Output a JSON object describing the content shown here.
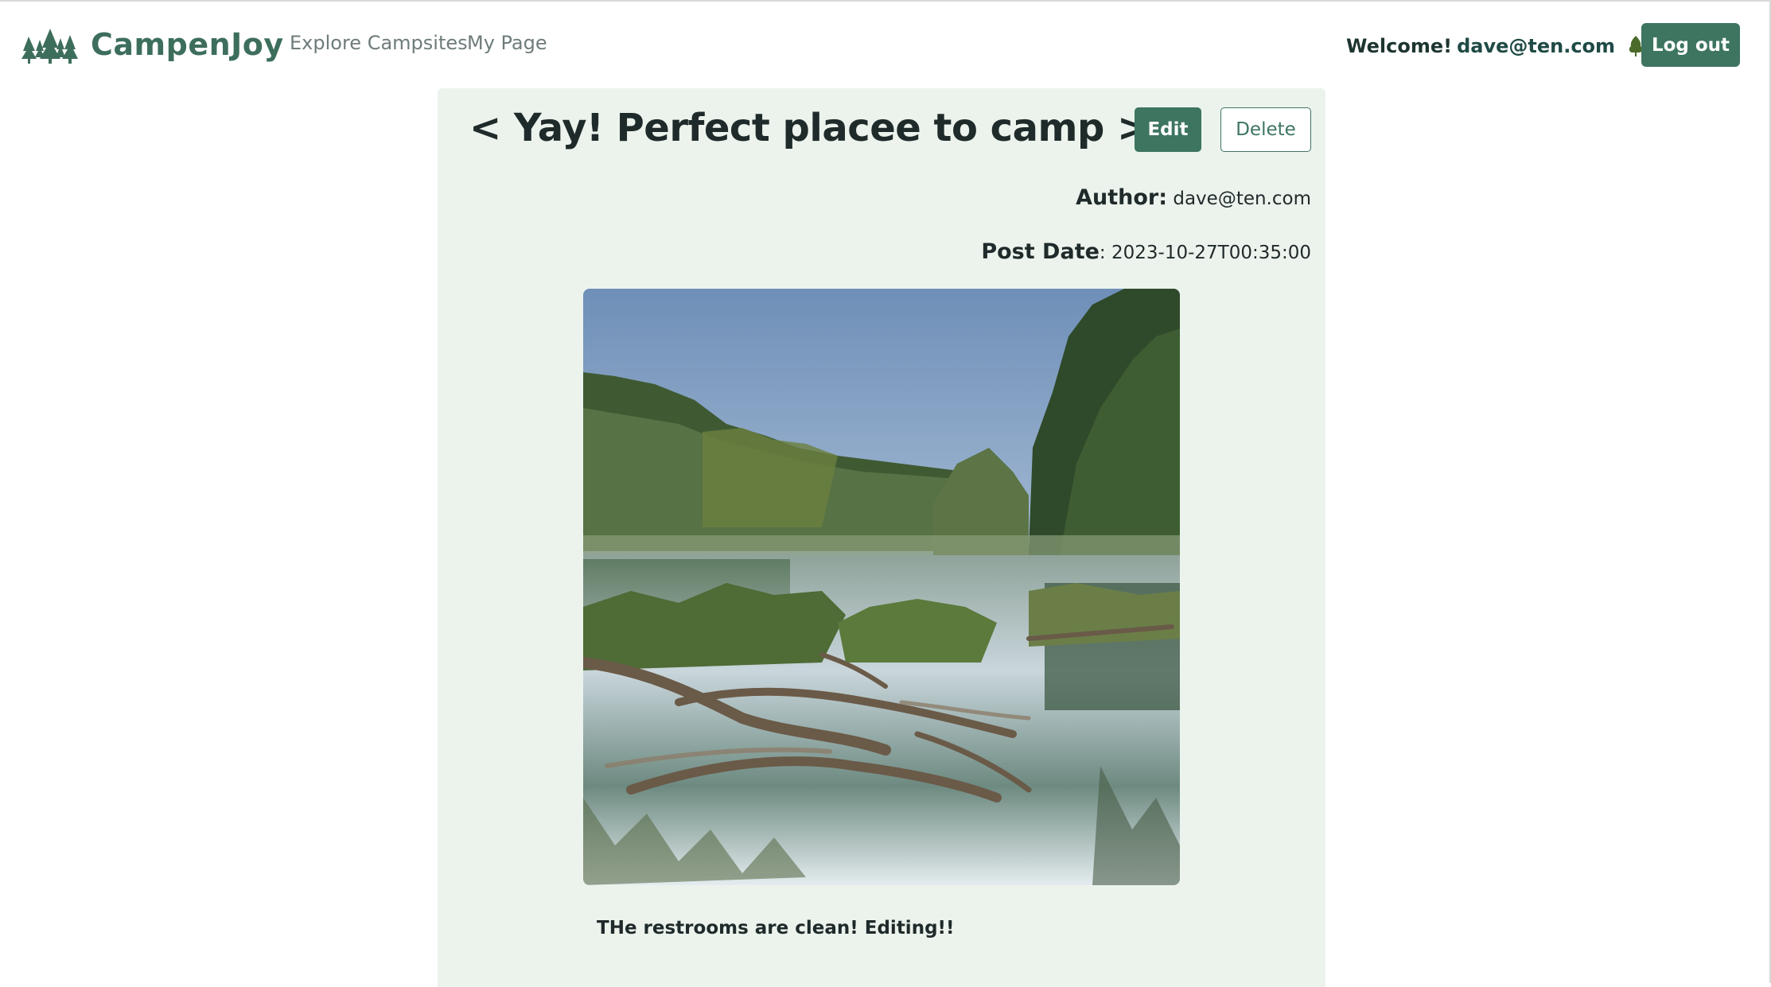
{
  "navbar": {
    "brand": "CampenJoy",
    "links": [
      "Explore Campsites",
      "My Page"
    ],
    "welcome_text": "Welcome!",
    "welcome_email": "dave@ten.com",
    "logout_label": "Log out"
  },
  "post": {
    "title": "< Yay! Perfect placee to camp >",
    "edit_label": "Edit",
    "delete_label": "Delete",
    "author_label": "Author:",
    "author_value": "dave@ten.com",
    "date_label": "Post Date",
    "date_value": ": 2023-10-27T00:35:00",
    "body": "THe restrooms are clean! Editing!!"
  },
  "icons": {
    "brand_logo": "pine-trees-icon",
    "welcome_icon": "tree-icon"
  },
  "colors": {
    "brand": "#3d6e5c",
    "primary_button": "#3d7560",
    "card_background": "#ecf3ed"
  }
}
